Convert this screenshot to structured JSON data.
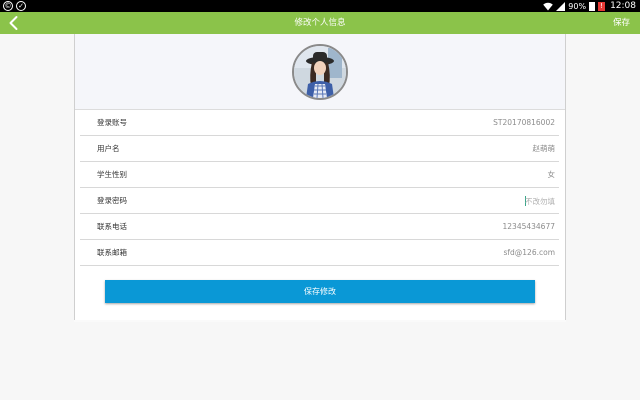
{
  "status_bar": {
    "battery": "90%",
    "time": "12:08"
  },
  "header": {
    "title": "修改个人信息",
    "save_label": "保存"
  },
  "form": {
    "rows": [
      {
        "label": "登录账号",
        "value": "ST20170816002"
      },
      {
        "label": "用户名",
        "value": "赵萌萌"
      },
      {
        "label": "学生性别",
        "value": "女"
      },
      {
        "label": "登录密码",
        "placeholder": "不改勿填"
      },
      {
        "label": "联系电话",
        "value": "12345434677"
      },
      {
        "label": "联系邮箱",
        "value": "sfd@126.com"
      }
    ],
    "submit_label": "保存修改"
  },
  "colors": {
    "appbar": "#8bc34a",
    "button": "#0a98d6"
  },
  "icons": {
    "back": "chevron-left-icon",
    "wifi": "wifi-icon",
    "battery": "battery-icon"
  }
}
